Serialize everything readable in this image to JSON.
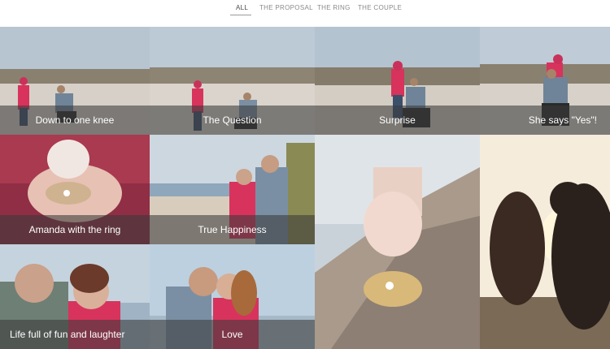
{
  "nav": {
    "tabs": [
      {
        "label": "ALL",
        "active": true
      },
      {
        "label": "THE PROPOSAL",
        "active": false
      },
      {
        "label": "THE RING",
        "active": false
      },
      {
        "label": "THE COUPLE",
        "active": false
      }
    ]
  },
  "gallery": {
    "tiles": [
      {
        "caption": "Down to one knee",
        "icon": "photo-beach-proposal"
      },
      {
        "caption": "The Question",
        "icon": "photo-beach-question"
      },
      {
        "caption": "Surprise",
        "icon": "photo-beach-surprise"
      },
      {
        "caption": "She says \"Yes\"!",
        "icon": "photo-beach-yes"
      },
      {
        "caption": "Amanda with the ring",
        "icon": "photo-ring-in-hand"
      },
      {
        "caption": "True Happiness",
        "icon": "photo-couple-dunes"
      },
      {
        "caption": "",
        "icon": "photo-ring-shell-driftwood"
      },
      {
        "caption": "",
        "icon": "photo-couple-silhouette-sunset"
      },
      {
        "caption": "Life full of fun and laughter",
        "icon": "photo-couple-laughing"
      },
      {
        "caption": "Love",
        "icon": "photo-couple-kiss"
      }
    ]
  },
  "colors": {
    "sky": "#b9c6d2",
    "sand": "#d9d3cb",
    "jacket_pink": "#d8335c",
    "jacket_blue": "#7a8fa3",
    "sunset": "#f4e3b8",
    "caption_bg": "#3a3a3a"
  }
}
